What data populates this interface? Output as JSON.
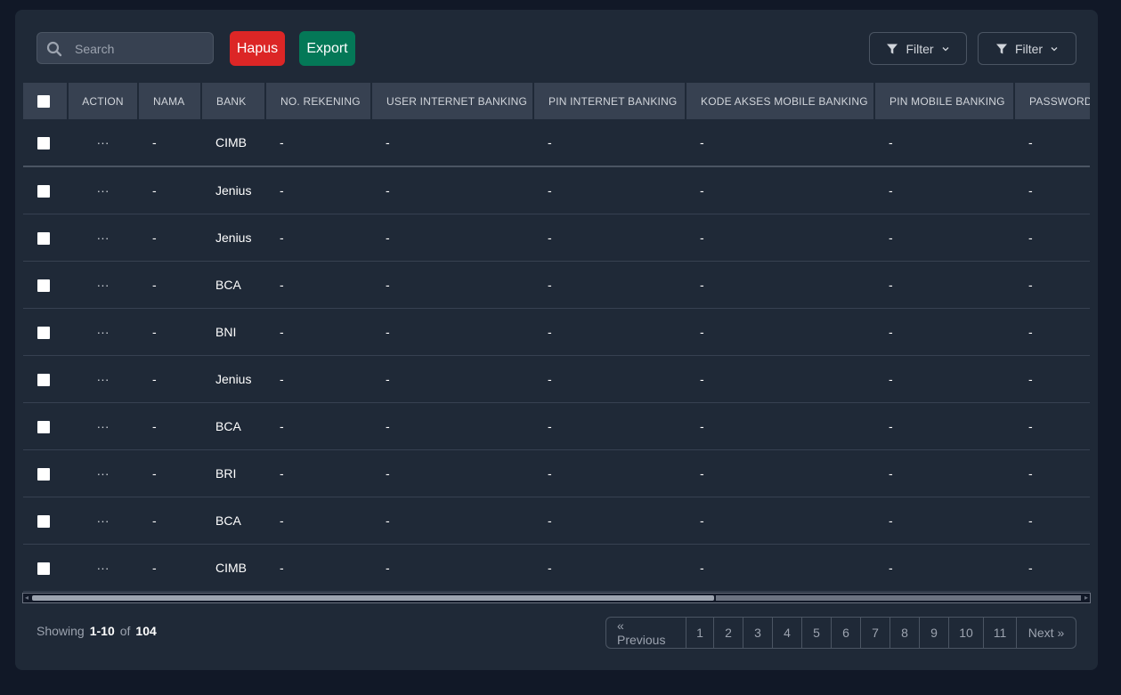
{
  "search": {
    "placeholder": "Search"
  },
  "actions": {
    "delete_label": "Hapus",
    "export_label": "Export"
  },
  "filters": [
    {
      "label": "Filter"
    },
    {
      "label": "Filter"
    }
  ],
  "table": {
    "columns": [
      "ACTION",
      "NAMA",
      "BANK",
      "NO. REKENING",
      "USER INTERNET BANKING",
      "PIN INTERNET BANKING",
      "KODE AKSES MOBILE BANKING",
      "PIN MOBILE BANKING",
      "PASSWORD"
    ],
    "rows": [
      {
        "action": "···",
        "nama": "-",
        "bank": "CIMB",
        "rekening": "-",
        "user_ib": "-",
        "pin_ib": "-",
        "kode_mb": "-",
        "pin_mb": "-",
        "password": "-"
      },
      {
        "action": "···",
        "nama": "-",
        "bank": "Jenius",
        "rekening": "-",
        "user_ib": "-",
        "pin_ib": "-",
        "kode_mb": "-",
        "pin_mb": "-",
        "password": "-"
      },
      {
        "action": "···",
        "nama": "-",
        "bank": "Jenius",
        "rekening": "-",
        "user_ib": "-",
        "pin_ib": "-",
        "kode_mb": "-",
        "pin_mb": "-",
        "password": "-"
      },
      {
        "action": "···",
        "nama": "-",
        "bank": "BCA",
        "rekening": "-",
        "user_ib": "-",
        "pin_ib": "-",
        "kode_mb": "-",
        "pin_mb": "-",
        "password": "-"
      },
      {
        "action": "···",
        "nama": "-",
        "bank": "BNI",
        "rekening": "-",
        "user_ib": "-",
        "pin_ib": "-",
        "kode_mb": "-",
        "pin_mb": "-",
        "password": "-"
      },
      {
        "action": "···",
        "nama": "-",
        "bank": "Jenius",
        "rekening": "-",
        "user_ib": "-",
        "pin_ib": "-",
        "kode_mb": "-",
        "pin_mb": "-",
        "password": "-"
      },
      {
        "action": "···",
        "nama": "-",
        "bank": "BCA",
        "rekening": "-",
        "user_ib": "-",
        "pin_ib": "-",
        "kode_mb": "-",
        "pin_mb": "-",
        "password": "-"
      },
      {
        "action": "···",
        "nama": "-",
        "bank": "BRI",
        "rekening": "-",
        "user_ib": "-",
        "pin_ib": "-",
        "kode_mb": "-",
        "pin_mb": "-",
        "password": "-"
      },
      {
        "action": "···",
        "nama": "-",
        "bank": "BCA",
        "rekening": "-",
        "user_ib": "-",
        "pin_ib": "-",
        "kode_mb": "-",
        "pin_mb": "-",
        "password": "-"
      },
      {
        "action": "···",
        "nama": "-",
        "bank": "CIMB",
        "rekening": "-",
        "user_ib": "-",
        "pin_ib": "-",
        "kode_mb": "-",
        "pin_mb": "-",
        "password": "-"
      }
    ]
  },
  "footer": {
    "showing_label": "Showing",
    "range": "1-10",
    "of_label": "of",
    "total": "104"
  },
  "pagination": {
    "previous": "« Previous",
    "pages": [
      "1",
      "2",
      "3",
      "4",
      "5",
      "6",
      "7",
      "8",
      "9",
      "10",
      "11"
    ],
    "next": "Next »"
  },
  "colors": {
    "background": "#111827",
    "card": "#1f2937",
    "delete": "#dc2626",
    "export": "#047857"
  }
}
